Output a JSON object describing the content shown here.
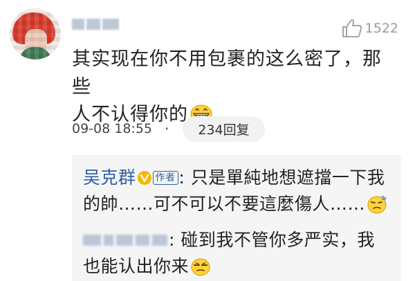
{
  "comment": {
    "likes": "1522",
    "text_line1": "其实现在你不用包裹的这么密了，那些",
    "text_line2": "人不认得你的",
    "timestamp": "09-08 18:55",
    "separator": "·",
    "reply_count_label": "234回复"
  },
  "replies": [
    {
      "author": "吴克群",
      "author_tag": "作者",
      "colon": ": ",
      "text_line1": "只是單純地想遮擋一下我",
      "text_line2": "的帥……可不可以不要這麼傷人……"
    },
    {
      "colon": ": ",
      "text_line1": "碰到我不管你多严实，我",
      "text_line2": "也能认出你来"
    }
  ],
  "icons": {
    "like": "thumbs-up-icon",
    "verified": "verified-v-icon",
    "grin_emoji": "grinning-emoji-icon",
    "sweat_emoji": "sweat-emoji-icon",
    "squint_emoji": "squint-emoji-icon"
  },
  "colors": {
    "author_link": "#2f5fa8",
    "muted_text": "#9a9a9a",
    "reply_bg": "#f5f5f5",
    "verified_badge": "#f5b800"
  }
}
